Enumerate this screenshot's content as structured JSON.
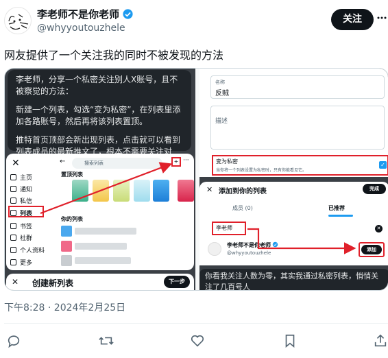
{
  "author": {
    "name": "李老师不是你老师",
    "handle": "@whyyoutouzhele",
    "follow_label": "关注",
    "more_label": "•••"
  },
  "tweet": {
    "text": "网友提供了一个关注我的同时不被发现的方法",
    "timestamp": "下午8:28 · 2024年2月25日"
  },
  "image_left": {
    "instructions": [
      "李老师，分享一个私密关注别人X账号，且不被察觉的方法：",
      "新建一个列表，勾选“变为私密”，在列表里添加各路账号，然后再将该列表置顶。",
      "推特首页顶部会新出现列表，点击就可以看到列表成员的最新推文了，根本不需要关注对方。"
    ],
    "nav": [
      "主页",
      "通知",
      "私信",
      "列表",
      "书签",
      "社群",
      "个人资料",
      "更多"
    ],
    "search_placeholder": "搜索列表",
    "pinned_title": "置顶列表",
    "your_lists_title": "你的列表",
    "create_title": "创建新列表",
    "next_label": "下一步"
  },
  "image_right": {
    "name_label": "名称",
    "name_value": "反贼",
    "desc_label": "描述",
    "private_title": "变为私密",
    "private_desc": "当你将一个列表设置为私密时，只有你能看见它。",
    "modal_title": "添加到你的列表",
    "done_label": "完成",
    "tab_members": "成员 (0)",
    "tab_recommended": "已推荐",
    "search_value": "李老师",
    "user_name": "李老师不是你老师",
    "user_handle": "@whyyoutouzhele",
    "add_label": "添加",
    "bottom_text": "你看我关注人数为零，其实我通过私密列表，悄悄关注了几百号人"
  },
  "colors": {
    "accent": "#1d9bf0",
    "highlight": "#e0202a",
    "text_secondary": "#536471"
  },
  "icons": [
    "reply-icon",
    "retweet-icon",
    "like-icon",
    "bookmark-icon",
    "share-icon",
    "verified-badge-icon"
  ]
}
